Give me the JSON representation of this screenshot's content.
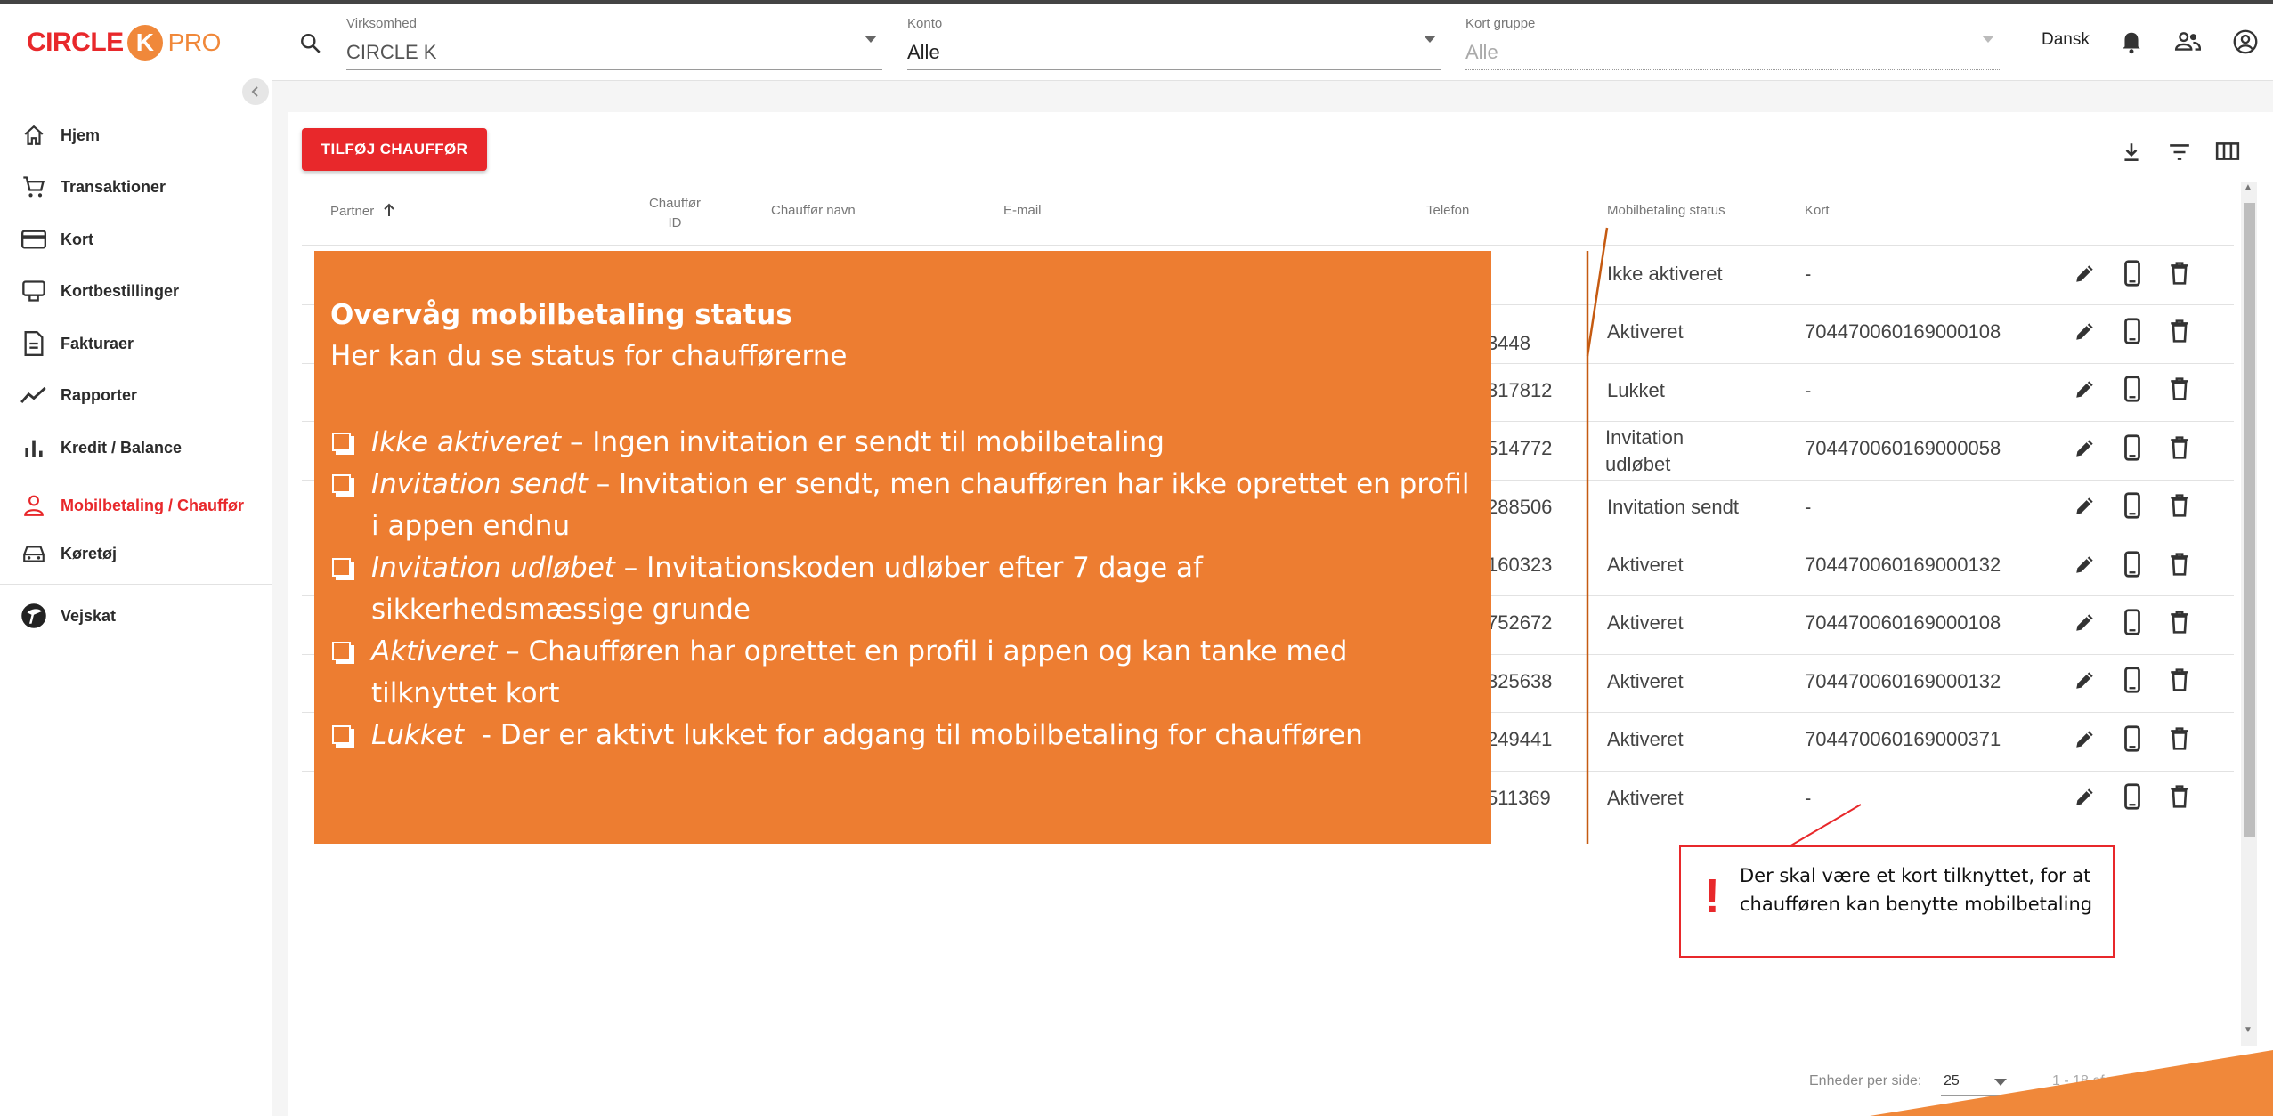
{
  "brand": {
    "name": "CIRCLE",
    "k": "K",
    "pro": "PRO",
    "red": "#e8282b",
    "orange": "#f0883a"
  },
  "header": {
    "company": {
      "label": "Virksomhed",
      "value": "CIRCLE K"
    },
    "account": {
      "label": "Konto",
      "value": "Alle"
    },
    "card_group": {
      "label": "Kort gruppe",
      "value": "Alle"
    },
    "language": "Dansk"
  },
  "sidebar": {
    "items": [
      {
        "label": "Hjem",
        "icon": "home-icon"
      },
      {
        "label": "Transaktioner",
        "icon": "cart-icon"
      },
      {
        "label": "Kort",
        "icon": "card-icon"
      },
      {
        "label": "Kortbestillinger",
        "icon": "card-order-icon"
      },
      {
        "label": "Fakturaer",
        "icon": "document-icon"
      },
      {
        "label": "Rapporter",
        "icon": "trend-icon"
      },
      {
        "label": "Kredit / Balance",
        "icon": "bar-chart-icon"
      },
      {
        "label": "Mobilbetaling / Chauffør",
        "icon": "person-icon",
        "active": true
      },
      {
        "label": "Køretøj",
        "icon": "car-icon"
      },
      {
        "label": "Vejskat",
        "icon": "road-toll-icon"
      }
    ]
  },
  "toolbar": {
    "add_driver": "TILFØJ CHAUFFØR"
  },
  "table": {
    "columns": {
      "partner": "Partner",
      "driver_id_1": "Chauffør",
      "driver_id_2": "ID",
      "driver_name": "Chauffør navn",
      "email": "E-mail",
      "phone": "Telefon",
      "status": "Mobilbetaling status",
      "card": "Kort"
    },
    "rows": [
      {
        "phone": "",
        "status": "Ikke aktiveret",
        "card": "-"
      },
      {
        "phone": "3448",
        "status": "Aktiveret",
        "card": "704470060169000108"
      },
      {
        "phone": "317812",
        "status": "Lukket",
        "card": "-"
      },
      {
        "phone": "514772",
        "status": "Invitation udløbet",
        "status_l1": "Invitation",
        "status_l2": "udløbet",
        "card": "704470060169000058"
      },
      {
        "phone": "288506",
        "status": "Invitation sendt",
        "card": "-"
      },
      {
        "phone": "160323",
        "status": "Aktiveret",
        "card": "704470060169000132"
      },
      {
        "phone": "752672",
        "status": "Aktiveret",
        "card": "704470060169000108"
      },
      {
        "phone": "325638",
        "status": "Aktiveret",
        "card": "704470060169000132"
      },
      {
        "phone": "249441",
        "status": "Aktiveret",
        "card": "704470060169000371"
      },
      {
        "phone": "511369",
        "status": "Aktiveret",
        "card": "-"
      }
    ]
  },
  "footer": {
    "per_page_label": "Enheder per side:",
    "per_page_value": "25",
    "range": "1 - 18 af ..."
  },
  "overlay": {
    "title": "Overvåg mobilbetaling status",
    "subtitle": "Her kan du se status for chaufførerne",
    "items": [
      {
        "term": "Ikke aktiveret",
        "desc": " – Ingen invitation er sendt til mobilbetaling"
      },
      {
        "term": "Invitation sendt",
        "desc": " – Invitation er sendt, men chaufføren har ikke oprettet en profil i appen endnu"
      },
      {
        "term": "Invitation udløbet",
        "desc": " – Invitationskoden udløber efter 7 dage af sikkerhedsmæssige grunde"
      },
      {
        "term": "Aktiveret",
        "desc": " – Chaufføren har oprettet en profil i appen og kan tanke med tilknyttet kort"
      },
      {
        "term": "Lukket",
        "desc": "  - Der er aktivt lukket for adgang til mobilbetaling for chaufføren"
      }
    ],
    "color": "#ed7d31"
  },
  "callout": {
    "mark": "!",
    "text": "Der skal være et kort tilknyttet, for at chaufføren kan benytte mobilbetaling"
  }
}
